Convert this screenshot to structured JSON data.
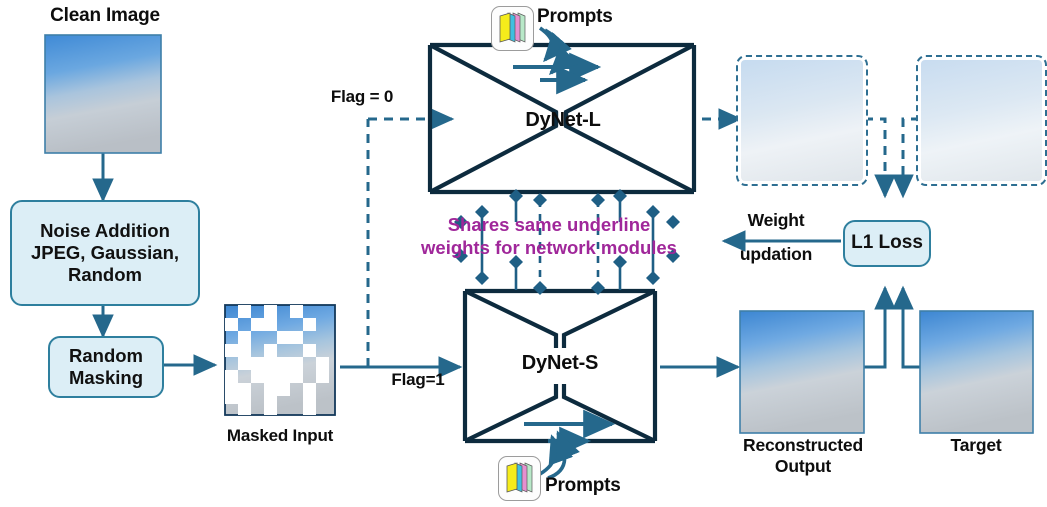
{
  "title": "DyNet training pipeline diagram",
  "labels": {
    "clean_image": "Clean Image",
    "noise_box": "Noise Addition\nJPEG, Gaussian,\nRandom",
    "noise_box_l1": "Noise Addition",
    "noise_box_l2": "JPEG, Gaussian,",
    "noise_box_l3": "Random",
    "random_masking_l1": "Random",
    "random_masking_l2": "Masking",
    "masked_input": "Masked Input",
    "flag0": "Flag = 0",
    "flag1": "Flag=1",
    "dynet_l": "DyNet-L",
    "dynet_s": "DyNet-S",
    "prompts_top": "Prompts",
    "prompts_bottom": "Prompts",
    "shares_l1": "Shares same underline",
    "shares_l2": "weights for network modules",
    "weight_l1": "Weight",
    "weight_l2": "updation",
    "l1_loss": "L1 Loss",
    "reconstructed_l1": "Reconstructed",
    "reconstructed_l2": "Output",
    "target": "Target"
  },
  "icons": {
    "prompt_stack": "stacked-cards-icon",
    "arrow_head": "arrow-head-icon",
    "diamond": "diamond-marker-icon"
  },
  "colors": {
    "teal_stroke": "#2e7f9e",
    "arrow_blue": "#25688c",
    "network_outline": "#0d2b3e",
    "box_fill": "#dceef6",
    "purple_text": "#a0279a",
    "diamond": "#1f5f85",
    "sky_top": "#3f87d0",
    "sky_bottom": "#c9ced3",
    "prompt_yellow": "#f5ec1b",
    "prompt_blue": "#3fbfe0",
    "prompt_pink": "#e58fd0",
    "prompt_green": "#b8e8c8"
  },
  "chart_data": {
    "type": "diagram",
    "nodes": [
      {
        "id": "clean-image",
        "label": "Clean Image",
        "kind": "image"
      },
      {
        "id": "noise-addition",
        "label": "Noise Addition JPEG, Gaussian, Random",
        "kind": "process"
      },
      {
        "id": "random-masking",
        "label": "Random Masking",
        "kind": "process"
      },
      {
        "id": "masked-input",
        "label": "Masked Input",
        "kind": "image"
      },
      {
        "id": "dynet-l",
        "label": "DyNet-L",
        "kind": "network"
      },
      {
        "id": "dynet-s",
        "label": "DyNet-S",
        "kind": "network"
      },
      {
        "id": "l1-loss",
        "label": "L1 Loss",
        "kind": "process"
      },
      {
        "id": "reconstructed-output",
        "label": "Reconstructed Output",
        "kind": "image"
      },
      {
        "id": "target",
        "label": "Target",
        "kind": "image"
      }
    ],
    "edges": [
      {
        "from": "clean-image",
        "to": "noise-addition",
        "style": "solid"
      },
      {
        "from": "noise-addition",
        "to": "random-masking",
        "style": "solid"
      },
      {
        "from": "random-masking",
        "to": "masked-input",
        "style": "solid"
      },
      {
        "from": "masked-input",
        "to": "dynet-l",
        "style": "dashed",
        "label": "Flag = 0"
      },
      {
        "from": "masked-input",
        "to": "dynet-s",
        "style": "solid",
        "label": "Flag=1"
      },
      {
        "from": "dynet-s",
        "to": "reconstructed-output",
        "style": "solid"
      },
      {
        "from": "reconstructed-output",
        "to": "l1-loss",
        "style": "solid"
      },
      {
        "from": "target",
        "to": "l1-loss",
        "style": "solid"
      },
      {
        "from": "l1-loss",
        "to": "dynet-s",
        "style": "solid",
        "label": "Weight updation"
      }
    ]
  }
}
